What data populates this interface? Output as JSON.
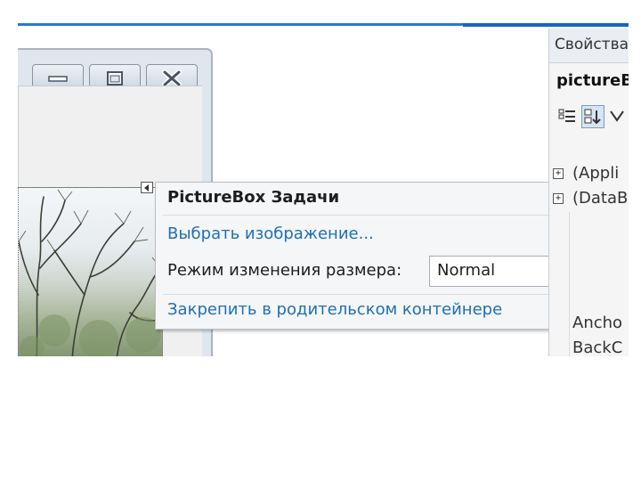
{
  "window_buttons": {
    "minimize_icon": "minimize-icon",
    "maximize_icon": "maximize-icon",
    "close_icon": "close-icon"
  },
  "picture_box": {
    "image": "tree-photo",
    "smart_tag_icon": "smart-tag-arrow-icon"
  },
  "tasks_panel": {
    "title": "PictureBox Задачи",
    "choose_image_link": "Выбрать изображение...",
    "size_mode_label": "Режим изменения размера:",
    "size_mode_value": "Normal",
    "dock_link": "Закрепить в родительском контейнере"
  },
  "properties": {
    "title": "Свойства",
    "object_name": "pictureB",
    "toolbar": [
      "categorized-icon",
      "alphabetical-icon",
      "properties-icon"
    ],
    "rows": [
      {
        "name": "(Appli",
        "expandable": true
      },
      {
        "name": "(DataB",
        "expandable": true
      },
      {
        "name": "",
        "expandable": false
      },
      {
        "name": "",
        "expandable": false
      },
      {
        "name": "",
        "expandable": false
      },
      {
        "name": "",
        "expandable": false
      },
      {
        "name": "Ancho",
        "expandable": false
      },
      {
        "name": "BackC",
        "expandable": false
      }
    ]
  },
  "colors": {
    "accent": "#1565c0",
    "link": "#1f6fb3"
  }
}
